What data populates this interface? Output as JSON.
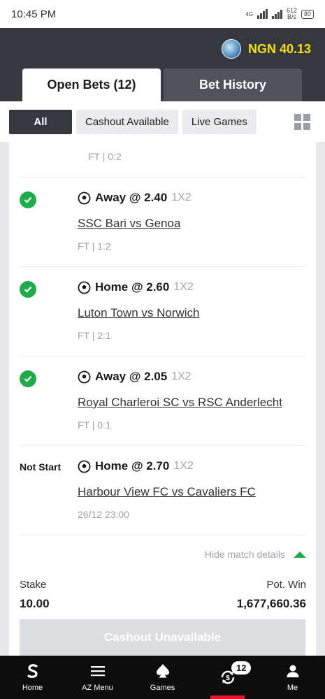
{
  "statusbar": {
    "time": "10:45 PM",
    "netspeed_value": "612",
    "netspeed_unit": "B/s",
    "battery": "80",
    "network_label": "4G"
  },
  "header": {
    "balance": "NGN 40.13"
  },
  "tabs": [
    {
      "label": "Open Bets (12)"
    },
    {
      "label": "Bet History"
    }
  ],
  "filters": [
    {
      "label": "All"
    },
    {
      "label": "Cashout Available"
    },
    {
      "label": "Live Games"
    }
  ],
  "first_meta": "FT | 0:2",
  "bets": [
    {
      "status": "won",
      "pick": "Away @ 2.40",
      "market": "1X2",
      "match": "SSC Bari vs Genoa",
      "meta": "FT | 1:2"
    },
    {
      "status": "won",
      "pick": "Home @ 2.60",
      "market": "1X2",
      "match": "Luton Town vs Norwich",
      "meta": "FT | 2:1"
    },
    {
      "status": "won",
      "pick": "Away @ 2.05",
      "market": "1X2",
      "match": "Royal Charleroi SC vs RSC Anderlecht",
      "meta": "FT | 0:1"
    },
    {
      "status": "Not Start",
      "pick": "Home @ 2.70",
      "market": "1X2",
      "match": "Harbour View FC vs Cavaliers FC",
      "meta": "26/12 23:00"
    }
  ],
  "details": {
    "hide_label": "Hide match details"
  },
  "summary": {
    "stake_label": "Stake",
    "stake_value": "10.00",
    "win_label": "Pot. Win",
    "win_value": "1,677,660.36"
  },
  "cashout_label": "Cashout Unavailable",
  "bottomnav": [
    {
      "label": "Home",
      "icon": "sporty-logo-icon"
    },
    {
      "label": "AZ Menu",
      "icon": "menu-icon"
    },
    {
      "label": "Games",
      "icon": "spade-icon"
    },
    {
      "label": "",
      "icon": "open-bets-icon",
      "badge": "12"
    },
    {
      "label": "Me",
      "icon": "user-icon"
    }
  ],
  "colors": {
    "header_bg": "#35383f",
    "balance": "#f6e10f",
    "won_green": "#1faa4c",
    "active_red": "#e8182a"
  }
}
